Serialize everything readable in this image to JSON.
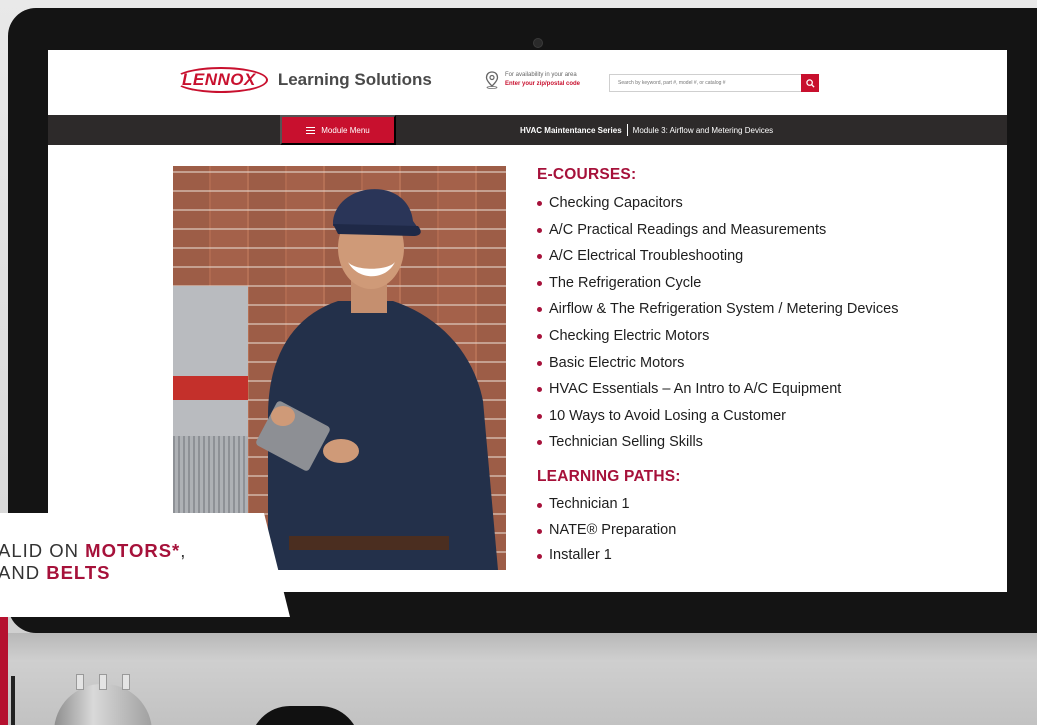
{
  "header": {
    "logo_mark": "LENNOX",
    "logo_text": "Learning Solutions",
    "zip_prompt": "For availability in your area",
    "zip_link": "Enter your zip/postal code",
    "search_placeholder": "Search by keyword, part #, model #, or catalog #"
  },
  "nav": {
    "module_menu": "Module Menu",
    "series": "HVAC Maintentance Series",
    "module": "Module 3: Airflow and Metering Devices"
  },
  "ecourses": {
    "heading": "E-COURSES:",
    "items": [
      "Checking Capacitors",
      "A/C Practical Readings and Measurements",
      "A/C Electrical Troubleshooting",
      "The Refrigeration Cycle",
      "Airflow & The Refrigeration System / Metering Devices",
      "Checking Electric Motors",
      "Basic Electric Motors",
      "HVAC Essentials – An Intro to A/C Equipment",
      "10 Ways to Avoid Losing a Customer",
      "Technician Selling Skills"
    ]
  },
  "learning_paths": {
    "heading": "LEARNING PATHS:",
    "items": [
      "Technician 1",
      "NATE® Preparation",
      "Installer 1"
    ]
  },
  "banner": {
    "line1_prefix": "ALID ON ",
    "line1_bold": "MOTORS*",
    "line1_suffix": ",",
    "line2_prefix": "AND ",
    "line2_bold": "BELTS"
  },
  "colors": {
    "brand_red": "#c8102e",
    "heading_red": "#a6113a",
    "nav_dark": "#2d2a2a"
  }
}
